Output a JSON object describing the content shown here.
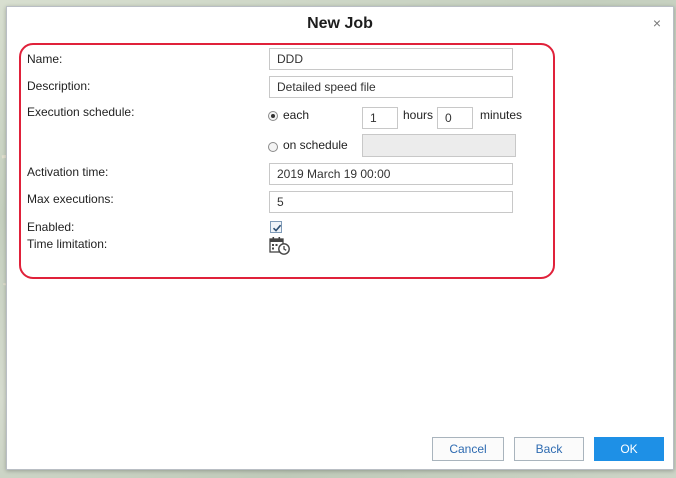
{
  "dialog": {
    "title": "New Job",
    "close_symbol": "×"
  },
  "form": {
    "name_label": "Name:",
    "name_value": "DDD",
    "description_label": "Description:",
    "description_value": "Detailed speed file",
    "execution_label": "Execution schedule:",
    "each_label": "each",
    "hours_value": "1",
    "hours_label": "hours",
    "minutes_value": "0",
    "minutes_label": "minutes",
    "on_schedule_label": "on schedule",
    "on_schedule_value": "",
    "schedule_mode": "each",
    "activation_label": "Activation time:",
    "activation_value": "2019 March 19 00:00",
    "max_exec_label": "Max executions:",
    "max_exec_value": "5",
    "enabled_label": "Enabled:",
    "enabled_checked": true,
    "time_limitation_label": "Time limitation:",
    "time_limitation_icon": "calendar-clock-icon"
  },
  "buttons": {
    "cancel": "Cancel",
    "back": "Back",
    "ok": "OK"
  },
  "colors": {
    "highlight": "#e0213a",
    "primary_button": "#1e90e6"
  }
}
